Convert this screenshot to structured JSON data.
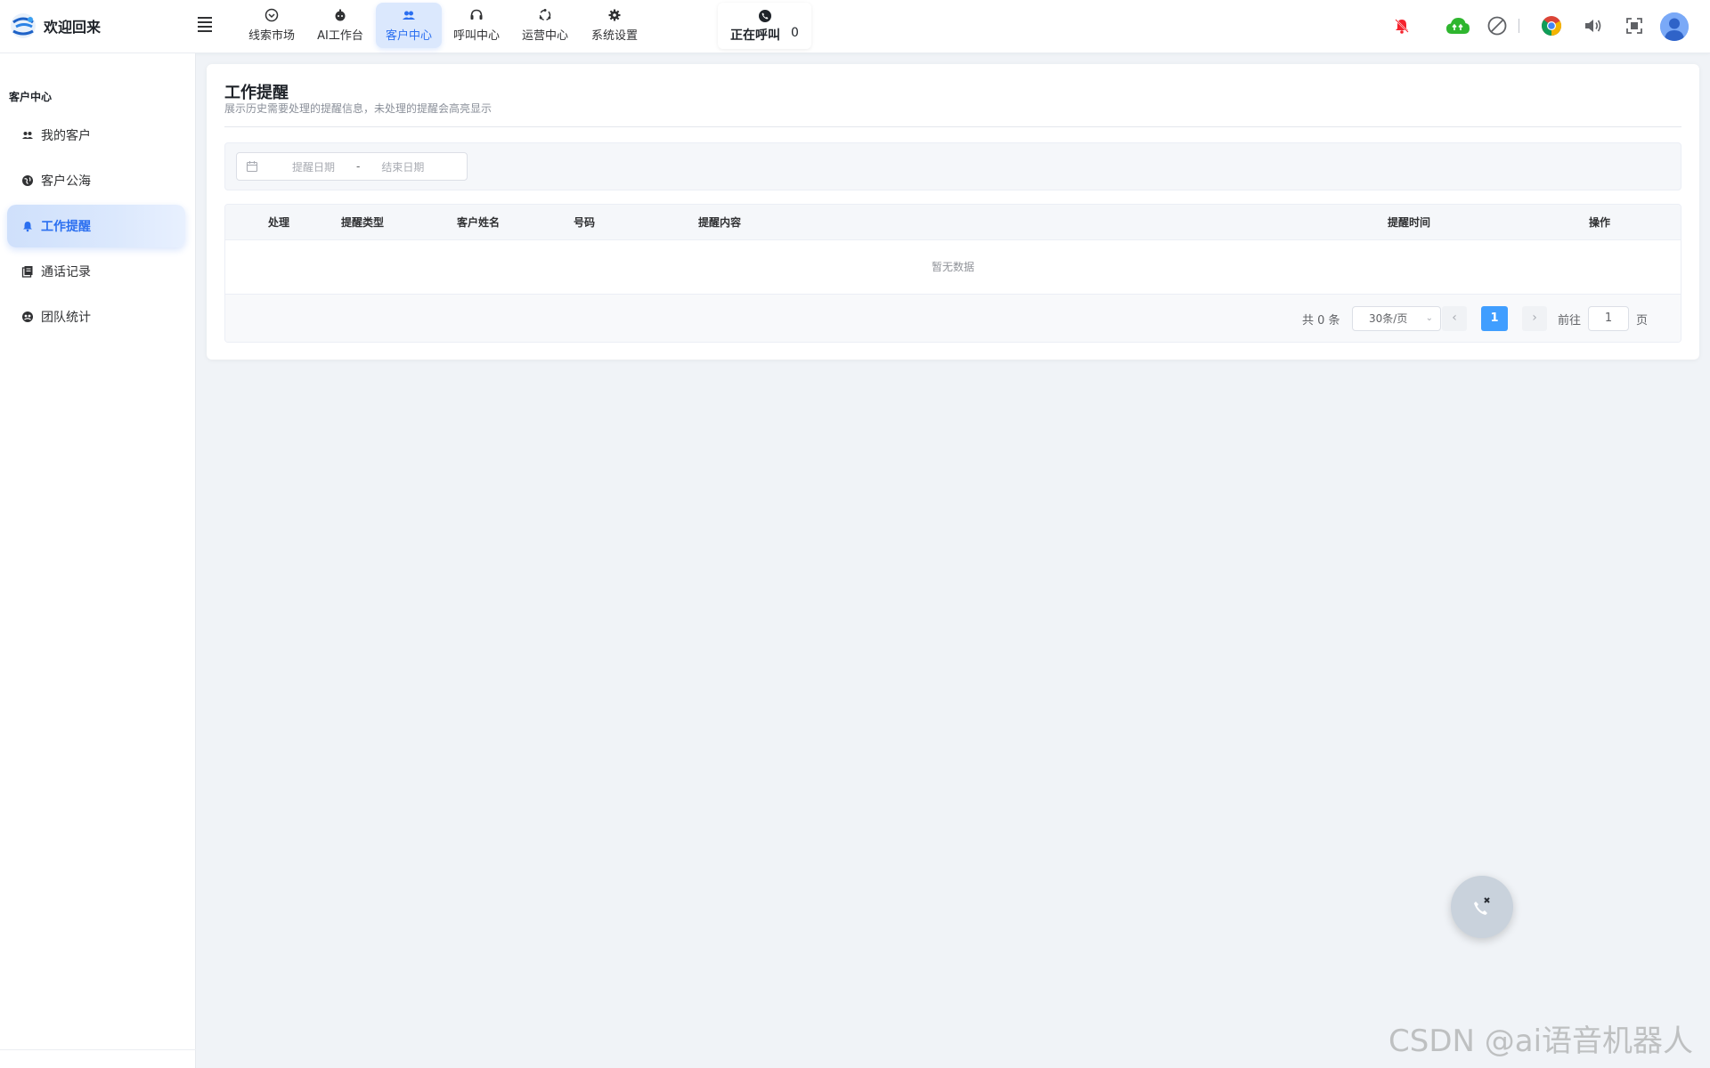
{
  "brand": {
    "title": "欢迎回来"
  },
  "nav": {
    "tabs": [
      {
        "label": "线索市场",
        "icon": "chevron-circle-icon"
      },
      {
        "label": "AI工作台",
        "icon": "robot-icon"
      },
      {
        "label": "客户中心",
        "icon": "users-icon",
        "active": true
      },
      {
        "label": "呼叫中心",
        "icon": "headset-icon"
      },
      {
        "label": "运营中心",
        "icon": "cycle-icon"
      },
      {
        "label": "系统设置",
        "icon": "gear-icon"
      }
    ],
    "calling": {
      "label": "正在呼叫",
      "count": "0"
    }
  },
  "sidebar": {
    "title": "客户中心",
    "items": [
      {
        "label": "我的客户",
        "icon": "users-icon"
      },
      {
        "label": "客户公海",
        "icon": "globe-icon"
      },
      {
        "label": "工作提醒",
        "icon": "bell-icon",
        "active": true
      },
      {
        "label": "通话记录",
        "icon": "book-icon"
      },
      {
        "label": "团队统计",
        "icon": "team-icon"
      }
    ]
  },
  "main": {
    "title": "工作提醒",
    "subtitle": "展示历史需要处理的提醒信息，未处理的提醒会高亮显示",
    "filter": {
      "start_placeholder": "提醒日期",
      "separator": "-",
      "end_placeholder": "结束日期"
    },
    "table": {
      "columns": [
        "处理",
        "提醒类型",
        "客户姓名",
        "号码",
        "提醒内容",
        "提醒时间",
        "操作"
      ],
      "empty_text": "暂无数据"
    },
    "pagination": {
      "total": "共 0 条",
      "page_size": "30条/页",
      "current_page": "1",
      "goto_label": "前往",
      "goto_value": "1",
      "page_unit": "页"
    }
  },
  "watermark": "CSDN @ai语音机器人",
  "colors": {
    "accent": "#2b6ff0",
    "page_active": "#409eff",
    "bell_red": "#f5222d",
    "cloud_green": "#2fb62f"
  }
}
